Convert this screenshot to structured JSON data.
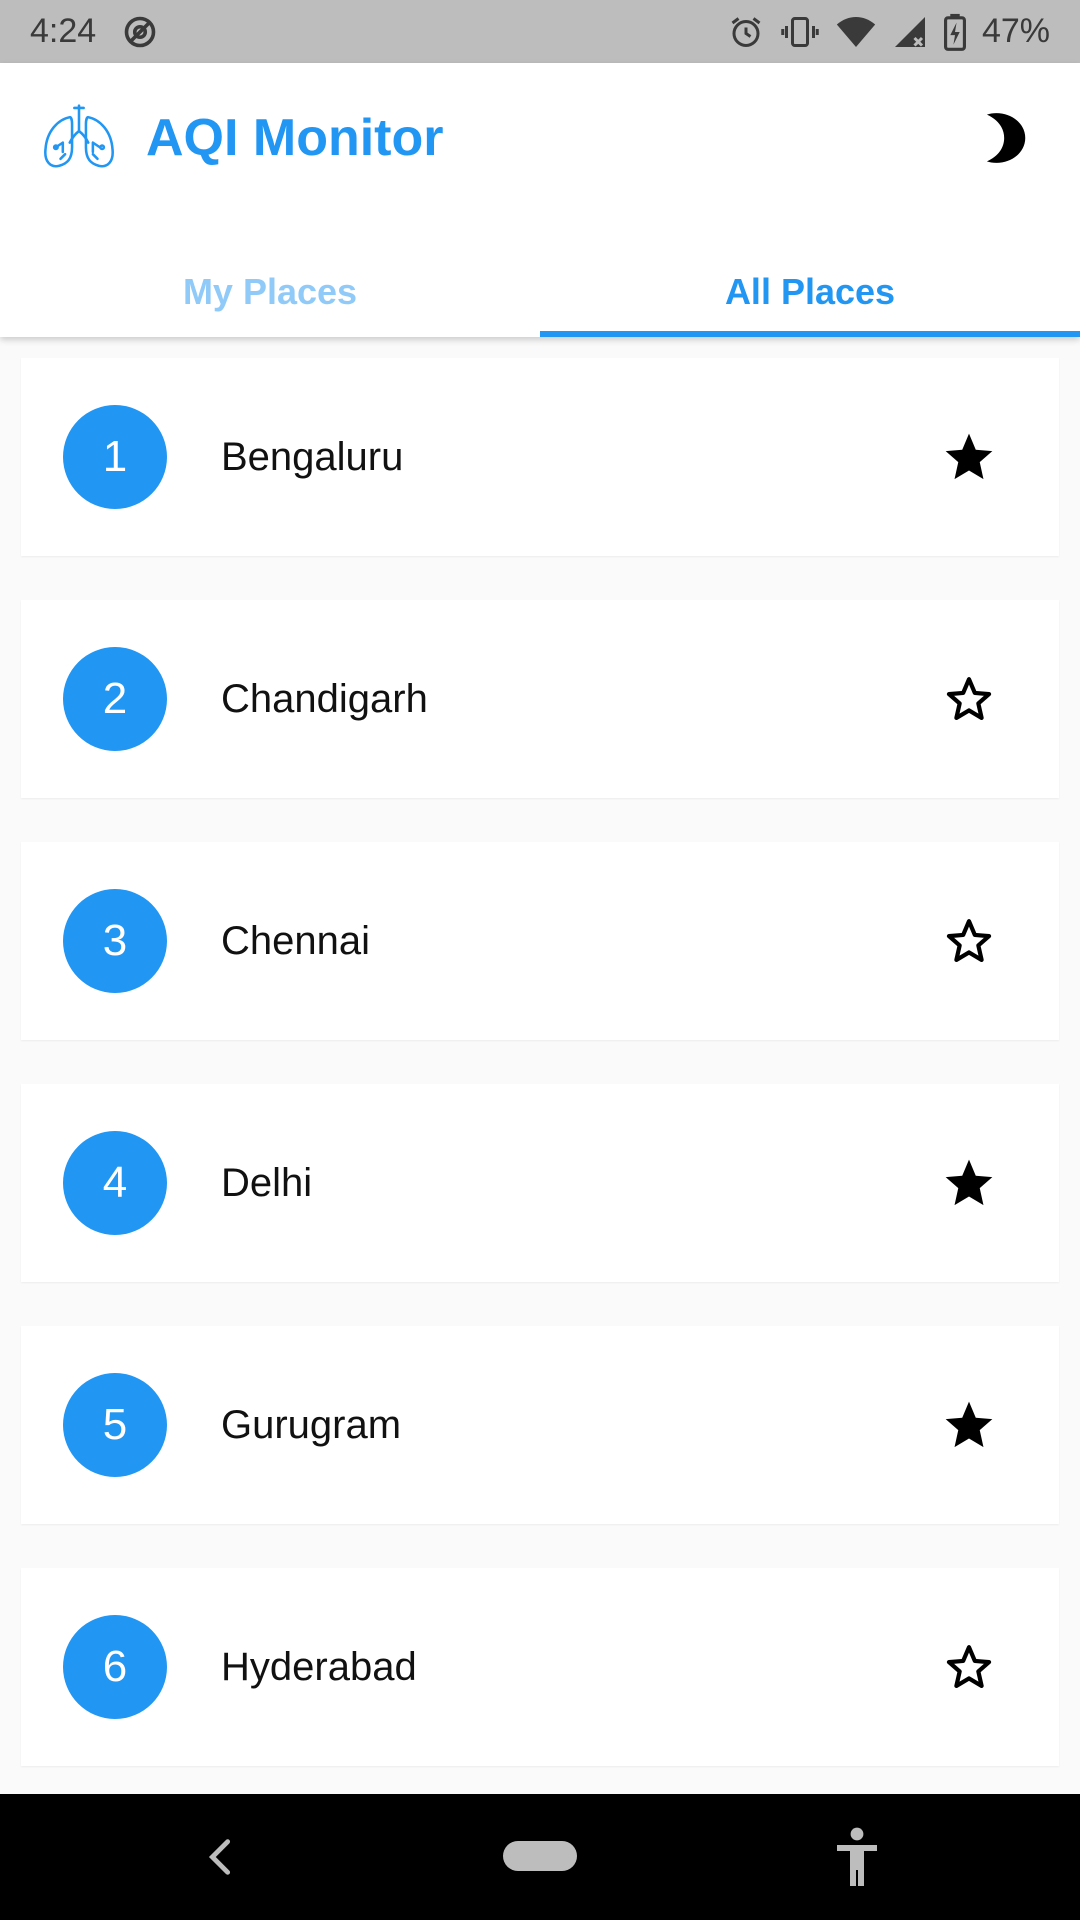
{
  "status_bar": {
    "time": "4:24",
    "battery": "47%",
    "icons": [
      "at-sign-icon",
      "alarm-icon",
      "vibrate-icon",
      "wifi-icon",
      "signal-icon",
      "battery-charging-icon"
    ]
  },
  "app": {
    "title": "AQI Monitor",
    "logo_icon": "lungs-icon",
    "theme_toggle_icon": "moon-icon",
    "accent_color": "#2196f3"
  },
  "tabs": [
    {
      "label": "My Places",
      "active": false
    },
    {
      "label": "All Places",
      "active": true
    }
  ],
  "places": [
    {
      "rank": "1",
      "name": "Bengaluru",
      "starred": true
    },
    {
      "rank": "2",
      "name": "Chandigarh",
      "starred": false
    },
    {
      "rank": "3",
      "name": "Chennai",
      "starred": false
    },
    {
      "rank": "4",
      "name": "Delhi",
      "starred": true
    },
    {
      "rank": "5",
      "name": "Gurugram",
      "starred": true
    },
    {
      "rank": "6",
      "name": "Hyderabad",
      "starred": false
    }
  ],
  "nav_bar": {
    "icons": [
      "back-icon",
      "home-pill-icon",
      "accessibility-icon"
    ]
  }
}
